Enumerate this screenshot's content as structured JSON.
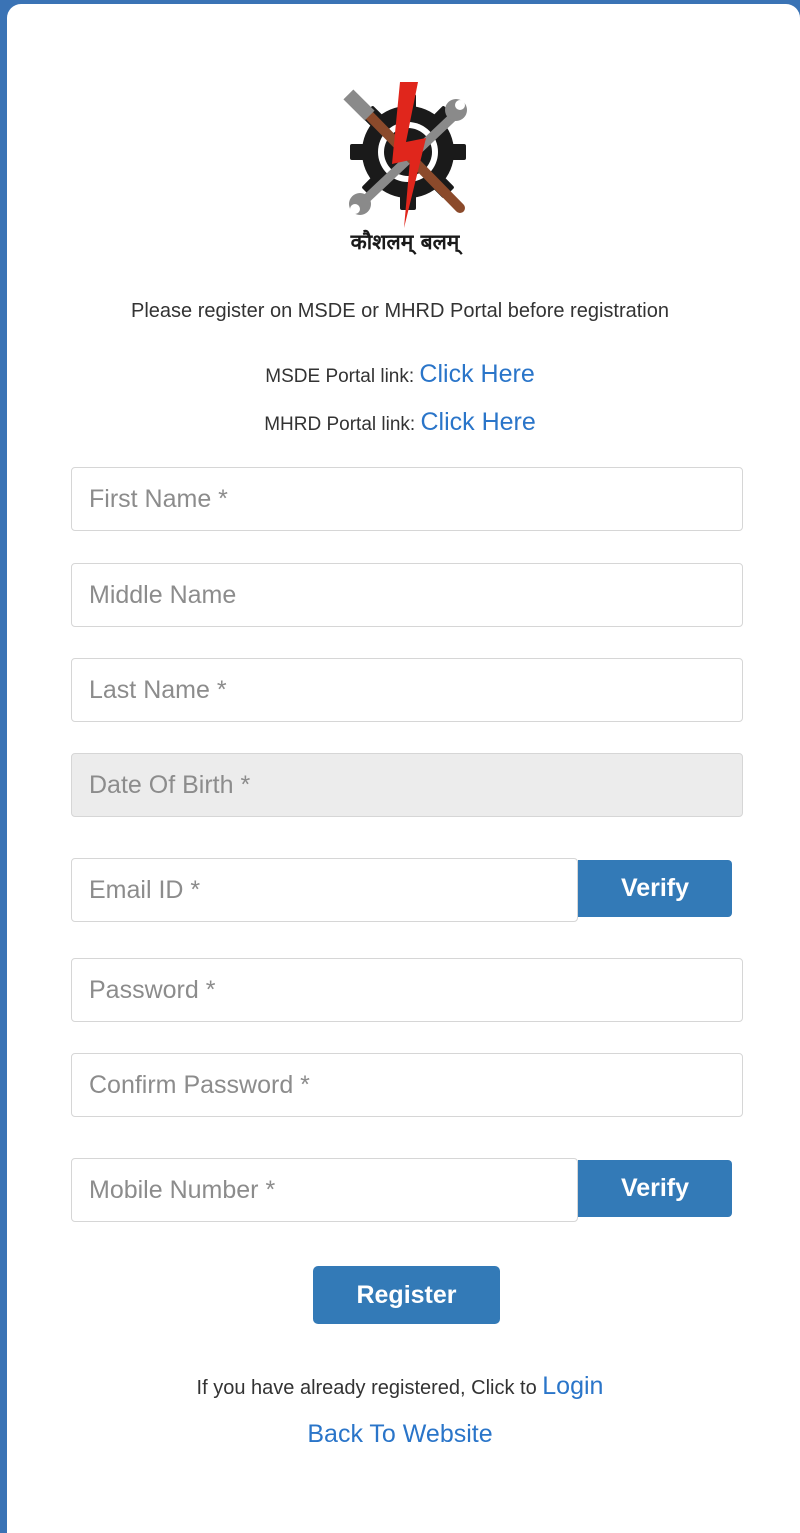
{
  "logo": {
    "text": "कौशलम् बलम्",
    "icon": "gear-wrench-lightning-logo"
  },
  "notice": "Please register on MSDE or MHRD Portal before registration",
  "portals": [
    {
      "label": "MSDE Portal link: ",
      "link_text": "Click Here"
    },
    {
      "label": "MHRD Portal link: ",
      "link_text": "Click Here"
    }
  ],
  "form": {
    "first_name": {
      "placeholder": "First Name *",
      "value": ""
    },
    "middle_name": {
      "placeholder": "Middle Name",
      "value": ""
    },
    "last_name": {
      "placeholder": "Last Name *",
      "value": ""
    },
    "dob": {
      "placeholder": "Date Of Birth *",
      "value": ""
    },
    "email": {
      "placeholder": "Email ID *",
      "value": "",
      "verify_label": "Verify"
    },
    "password": {
      "placeholder": "Password *",
      "value": ""
    },
    "confirm_password": {
      "placeholder": "Confirm Password *",
      "value": ""
    },
    "mobile": {
      "placeholder": "Mobile Number *",
      "value": "",
      "verify_label": "Verify"
    },
    "register_label": "Register"
  },
  "footer": {
    "login_prompt": "If you have already registered, Click to ",
    "login_link": "Login",
    "back_link": "Back To Website"
  },
  "colors": {
    "primary": "#337ab7",
    "link": "#2a75c9",
    "frame": "#3a73b5",
    "logo_red": "#e0261c"
  }
}
